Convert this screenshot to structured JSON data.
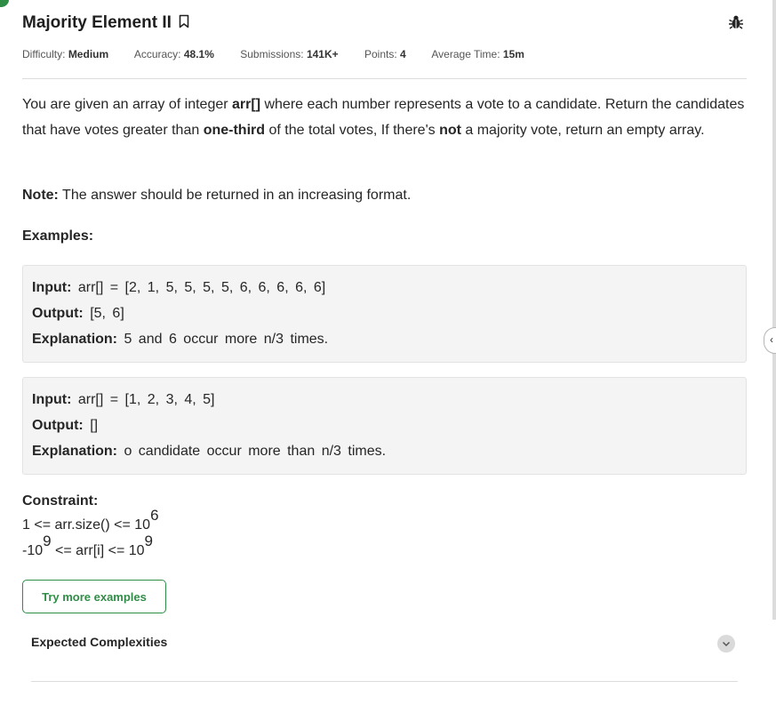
{
  "problem": {
    "title": "Majority Element II",
    "meta": [
      {
        "label": "Difficulty:",
        "value": "Medium"
      },
      {
        "label": "Accuracy:",
        "value": "48.1%"
      },
      {
        "label": "Submissions:",
        "value": "141K+"
      },
      {
        "label": "Points:",
        "value": "4"
      },
      {
        "label": "Average Time:",
        "value": "15m"
      }
    ],
    "description": {
      "p1": "You are given an array of integer ",
      "b1": "arr[]",
      "p2": " where each number represents a vote to a candidate. Return the candidates that have votes greater than ",
      "b2": "one-third",
      "p3": " of the total votes, If there's ",
      "b3": "not",
      "p4": " a majority vote, return an empty array."
    },
    "note": {
      "label": "Note:",
      "text": " The answer should be returned in an increasing format."
    },
    "examples_label": "Examples:",
    "examples": [
      {
        "input_label": "Input:",
        "input": " arr[] = [2, 1, 5, 5, 5, 5, 6, 6, 6, 6, 6]",
        "output_label": "Output:",
        "output": " [5, 6]",
        "explanation_label": "Explanation:",
        "explanation": " 5 and 6 occur more n/3 times."
      },
      {
        "input_label": "Input:",
        "input": " arr[] = [1, 2, 3, 4, 5]",
        "output_label": "Output:",
        "output": " []",
        "explanation_label": "Explanation:",
        "explanation": " o candidate occur more than n/3 times."
      }
    ],
    "constraint_label": "Constraint:",
    "constraints": [
      {
        "pre": "1 <= arr.size() <= 10",
        "sup": "6",
        "mid": "",
        "sup2": ""
      },
      {
        "pre": "-10",
        "sup": "9",
        "mid": " <= arr[i] <= 10",
        "sup2": "9"
      }
    ],
    "try_button_label": "Try more examples",
    "complexities_label": "Expected Complexities"
  },
  "colors": {
    "accent": "#2f8d46",
    "example_bg": "#f4f4f4"
  },
  "icons": [
    "bookmark-icon",
    "bug-icon",
    "chevron-down-icon",
    "chevron-left-icon"
  ]
}
